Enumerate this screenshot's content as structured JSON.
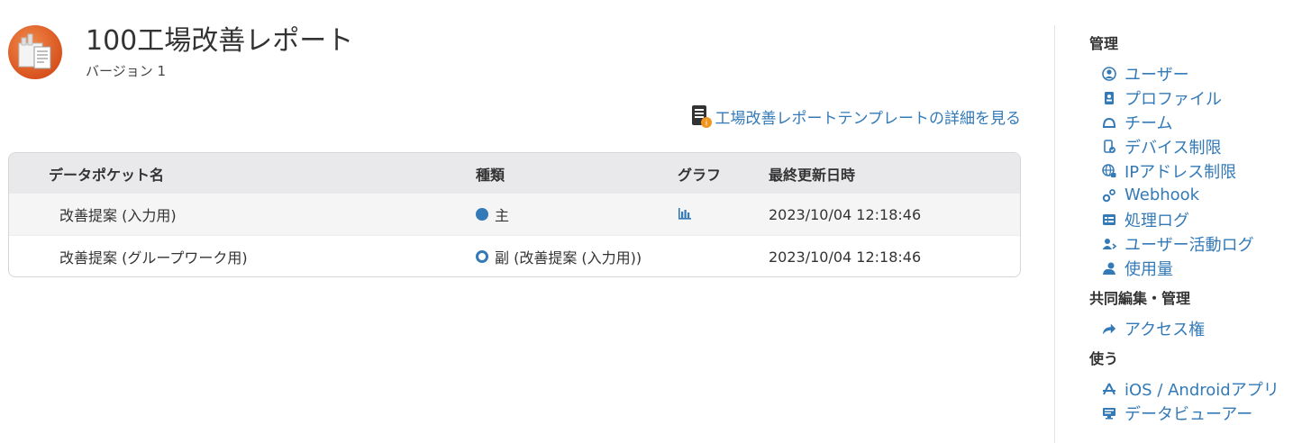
{
  "header": {
    "title": "100工場改善レポート",
    "version": "バージョン 1"
  },
  "template_link": {
    "label": "工場改善レポートテンプレートの詳細を見る"
  },
  "table": {
    "columns": [
      "データポケット名",
      "種類",
      "グラフ",
      "最終更新日時"
    ],
    "rows": [
      {
        "name": "改善提案 (入力用)",
        "kind": "主",
        "kind_type": "primary",
        "has_chart": true,
        "updated": "2023/10/04 12:18:46"
      },
      {
        "name": "改善提案 (グループワーク用)",
        "kind": "副 (改善提案 (入力用))",
        "kind_type": "secondary",
        "has_chart": false,
        "updated": "2023/10/04 12:18:46"
      }
    ]
  },
  "sidebar": {
    "sections": [
      {
        "title": "管理",
        "items": [
          {
            "label": "ユーザー",
            "icon": "user-circle-icon"
          },
          {
            "label": "プロファイル",
            "icon": "profile-card-icon"
          },
          {
            "label": "チーム",
            "icon": "team-icon"
          },
          {
            "label": "デバイス制限",
            "icon": "device-restriction-icon"
          },
          {
            "label": "IPアドレス制限",
            "icon": "globe-lock-icon"
          },
          {
            "label": "Webhook",
            "icon": "webhook-gears-icon"
          },
          {
            "label": "処理ログ",
            "icon": "process-log-icon"
          },
          {
            "label": "ユーザー活動ログ",
            "icon": "user-activity-icon"
          },
          {
            "label": "使用量",
            "icon": "usage-icon"
          }
        ]
      },
      {
        "title": "共同編集・管理",
        "items": [
          {
            "label": "アクセス権",
            "icon": "share-arrow-icon"
          }
        ]
      },
      {
        "title": "使う",
        "items": [
          {
            "label": "iOS / Androidアプリ",
            "icon": "app-store-icon"
          },
          {
            "label": "データビューアー",
            "icon": "data-viewer-icon"
          }
        ]
      }
    ]
  },
  "colors": {
    "link": "#337ab7",
    "accent_orange": "#e8672a",
    "header_bg": "#e9e9eb"
  }
}
